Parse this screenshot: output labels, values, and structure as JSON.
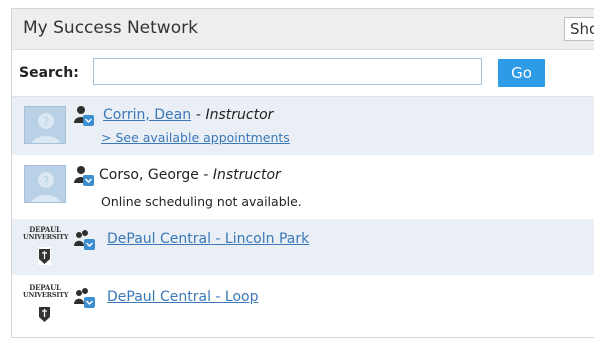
{
  "header": {
    "title": "My Success Network",
    "show_select": "Sho"
  },
  "search": {
    "label": "Search:",
    "value": "",
    "go_label": "Go"
  },
  "entries": [
    {
      "name": "Corrin, Dean",
      "role_sep": " - ",
      "role": "Instructor",
      "sub": "> See available appointments"
    },
    {
      "name": "Corso, George",
      "role_sep": " - ",
      "role": "Instructor",
      "sub": "Online scheduling not available."
    },
    {
      "name": "DePaul Central - Lincoln Park",
      "logo_line1": "DEPAUL",
      "logo_line2": "UNIVERSITY"
    },
    {
      "name": "DePaul Central - Loop",
      "logo_line1": "DEPAUL",
      "logo_line2": "UNIVERSITY"
    }
  ],
  "colors": {
    "accent": "#2d9be6",
    "link": "#3a78b8",
    "row_alt": "#e9eff5",
    "icon_person": "#2f2f2f",
    "icon_badge": "#3b8fd1"
  }
}
